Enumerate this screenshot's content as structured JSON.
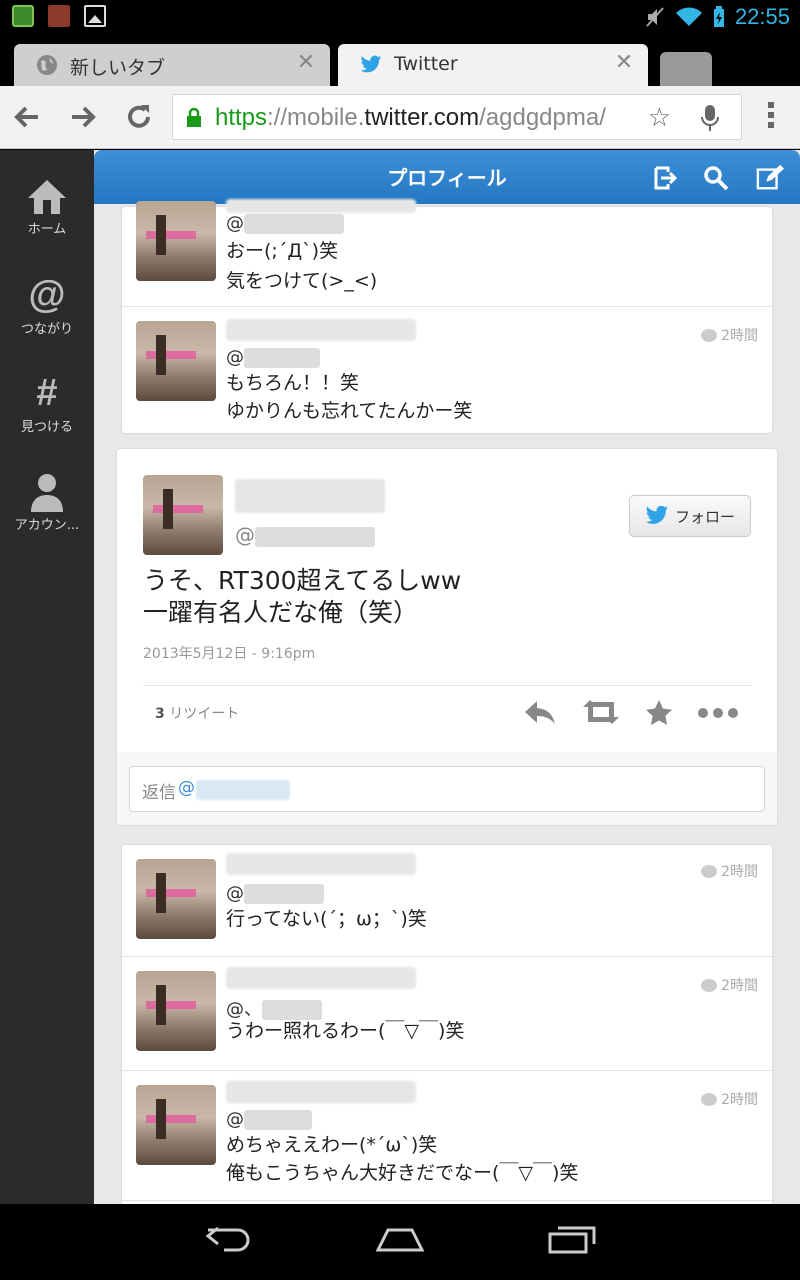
{
  "status_bar": {
    "time": "22:55"
  },
  "browser": {
    "tabs": [
      {
        "title": "新しいタブ",
        "active": false
      },
      {
        "title": "Twitter",
        "active": true
      }
    ],
    "url": {
      "scheme": "https",
      "sep": "://mobile.",
      "host": "twitter.com",
      "path": "/agdgdpma/"
    }
  },
  "sidebar": {
    "items": [
      {
        "label": "ホーム",
        "icon": "home-icon"
      },
      {
        "label": "つながり",
        "icon": "at-icon"
      },
      {
        "label": "見つける",
        "icon": "hash-icon"
      },
      {
        "label": "アカウン...",
        "icon": "user-icon"
      }
    ]
  },
  "header": {
    "title": "プロフィール"
  },
  "top_card": {
    "tweets": [
      {
        "handle_prefix": "@",
        "line1": "おー(;´Д`)笑",
        "line2": "気をつけて(>_<)",
        "time": ""
      },
      {
        "handle_prefix": "@",
        "line1": "もちろん！！笑",
        "line2": "ゆかりんも忘れてたんかー笑",
        "time": "2時間"
      }
    ]
  },
  "main_tweet": {
    "handle_prefix": "@",
    "follow_label": "フォロー",
    "line1": "うそ、RT300超えてるしww",
    "line2": "一躍有名人だな俺（笑）",
    "timestamp": "2013年5月12日 - 9:16pm",
    "retweet_count": "3",
    "retweet_label": "リツイート",
    "reply_placeholder_prefix": "返信",
    "reply_at": "@"
  },
  "bottom_card": {
    "tweets": [
      {
        "handle_prefix": "@",
        "line1": "行ってない(´；ω；`)笑",
        "line2": "",
        "time": "2時間"
      },
      {
        "handle_prefix": "@、",
        "line1": "うわー照れるわー(￣▽￣)笑",
        "line2": "",
        "time": "2時間"
      },
      {
        "handle_prefix": "@",
        "line1": "めちゃええわー(*´ω`)笑",
        "line2": "俺もこうちゃん大好きだでなー(￣▽￣)笑",
        "time": "2時間"
      }
    ]
  },
  "colors": {
    "twitter_blue": "#2f87d0",
    "status_blue": "#33b5e5",
    "https_green": "#1a9a1a"
  }
}
